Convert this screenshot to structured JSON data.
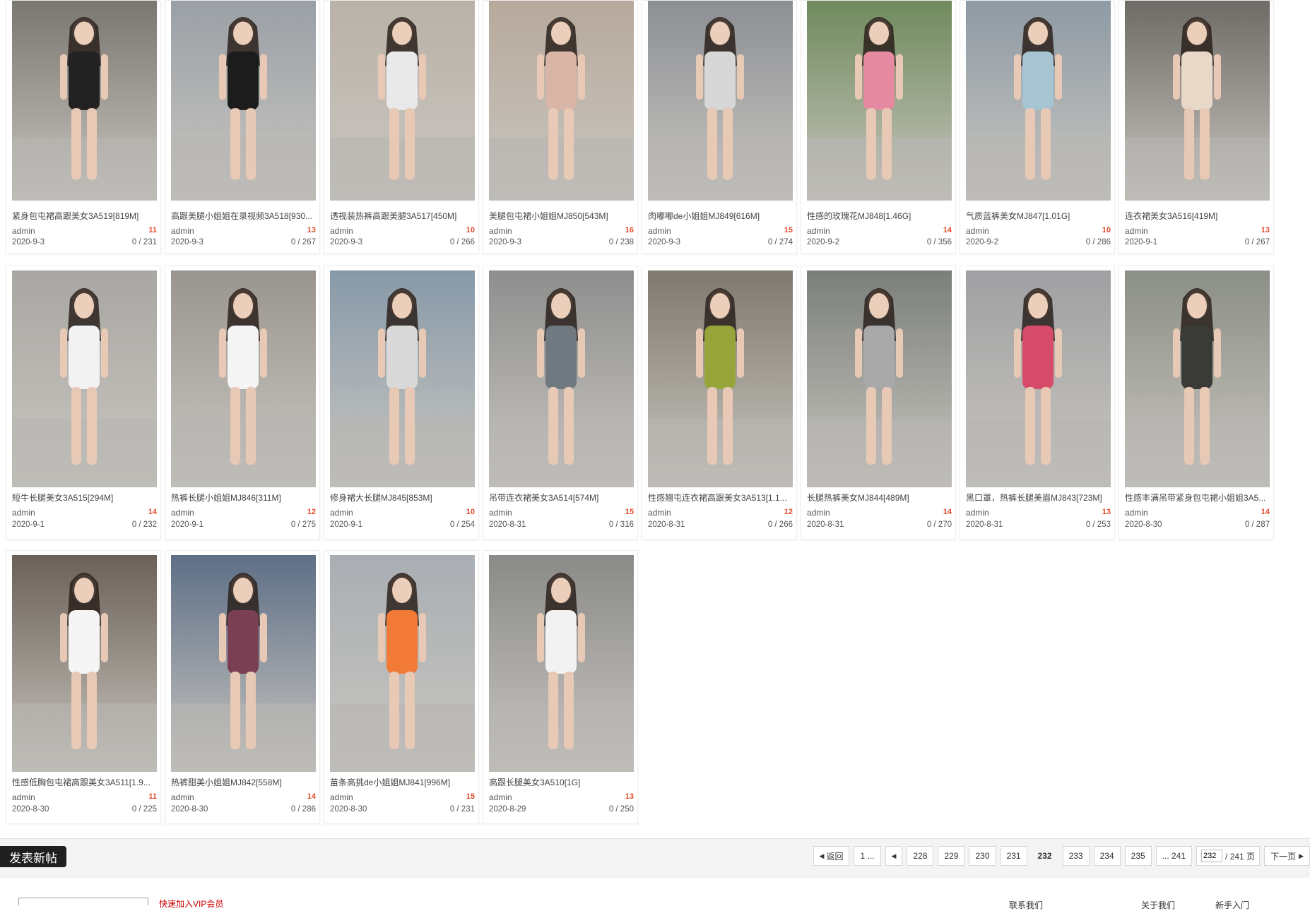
{
  "rows": [
    [
      {
        "title": "紧身包屯裙高跟美女3A519[819M]",
        "author": "admin",
        "comments": "11",
        "date": "2020-9-3",
        "stats": "0 / 231"
      },
      {
        "title": "高跟美腿小姐姐在录视频3A518[930...",
        "author": "admin",
        "comments": "13",
        "date": "2020-9-3",
        "stats": "0 / 267"
      },
      {
        "title": "透视装热裤高跟美腿3A517[450M]",
        "author": "admin",
        "comments": "10",
        "date": "2020-9-3",
        "stats": "0 / 266"
      },
      {
        "title": "美腿包屯裙小姐姐MJ850[543M]",
        "author": "admin",
        "comments": "16",
        "date": "2020-9-3",
        "stats": "0 / 238"
      },
      {
        "title": "肉嘟嘟de小姐姐MJ849[616M]",
        "author": "admin",
        "comments": "15",
        "date": "2020-9-3",
        "stats": "0 / 274"
      },
      {
        "title": "性感的玫瑰花MJ848[1.46G]",
        "author": "admin",
        "comments": "14",
        "date": "2020-9-2",
        "stats": "0 / 356"
      },
      {
        "title": "气质蓝裤美女MJ847[1.01G]",
        "author": "admin",
        "comments": "10",
        "date": "2020-9-2",
        "stats": "0 / 286"
      },
      {
        "title": "连衣裙美女3A516[419M]",
        "author": "admin",
        "comments": "13",
        "date": "2020-9-1",
        "stats": "0 / 267"
      }
    ],
    [
      {
        "title": "短牛长腿美女3A515[294M]",
        "author": "admin",
        "comments": "14",
        "date": "2020-9-1",
        "stats": "0 / 232"
      },
      {
        "title": "热裤长腿小姐姐MJ846[311M]",
        "author": "admin",
        "comments": "12",
        "date": "2020-9-1",
        "stats": "0 / 275"
      },
      {
        "title": "修身裙大长腿MJ845[853M]",
        "author": "admin",
        "comments": "10",
        "date": "2020-9-1",
        "stats": "0 / 254"
      },
      {
        "title": "吊带连衣裙美女3A514[574M]",
        "author": "admin",
        "comments": "15",
        "date": "2020-8-31",
        "stats": "0 / 316"
      },
      {
        "title": "性感翘屯连衣裙高跟美女3A513[1.1...",
        "author": "admin",
        "comments": "12",
        "date": "2020-8-31",
        "stats": "0 / 266"
      },
      {
        "title": "长腿热裤美女MJ844[489M]",
        "author": "admin",
        "comments": "14",
        "date": "2020-8-31",
        "stats": "0 / 270"
      },
      {
        "title": "黑口罩，热裤长腿美眉MJ843[723M]",
        "author": "admin",
        "comments": "13",
        "date": "2020-8-31",
        "stats": "0 / 253"
      },
      {
        "title": "性感丰满吊带紧身包屯裙小姐姐3A5...",
        "author": "admin",
        "comments": "14",
        "date": "2020-8-30",
        "stats": "0 / 287"
      }
    ],
    [
      {
        "title": "性感低胸包屯裙高跟美女3A511[1.9...",
        "author": "admin",
        "comments": "11",
        "date": "2020-8-30",
        "stats": "0 / 225"
      },
      {
        "title": "热裤甜美小姐姐MJ842[558M]",
        "author": "admin",
        "comments": "14",
        "date": "2020-8-30",
        "stats": "0 / 286"
      },
      {
        "title": "苗条高挑de小姐姐MJ841[996M]",
        "author": "admin",
        "comments": "15",
        "date": "2020-8-30",
        "stats": "0 / 231"
      },
      {
        "title": "高跟长腿美女3A510[1G]",
        "author": "admin",
        "comments": "13",
        "date": "2020-8-29",
        "stats": "0 / 250"
      }
    ]
  ],
  "thumb_colors": [
    [
      "#7a7670",
      "#9aa0a6",
      "#b9b2a8",
      "#b7a99c",
      "#8c8f94",
      "#6f8a5c",
      "#8e9aa4",
      "#6e6a66"
    ],
    [
      "#a9a7a3",
      "#9a9590",
      "#8799a8",
      "#8e8e8e",
      "#7f7a6f",
      "#7b7f7a",
      "#9fa0a2",
      "#8b8f86"
    ],
    [
      "#6b6158",
      "#5e6f86",
      "#a9aeb3",
      "#8a8a88"
    ]
  ],
  "outfit_colors": [
    [
      "#222222",
      "#1c1c1c",
      "#e9e9e9",
      "#d9b5a7",
      "#d7d7d7",
      "#e58aa0",
      "#a7c4d3",
      "#e7d8c7"
    ],
    [
      "#f2f2f2",
      "#f4f4f4",
      "#d9d9d9",
      "#707880",
      "#95a53a",
      "#a9a9a9",
      "#d64b6a",
      "#3a3a36"
    ],
    [
      "#f5f5f5",
      "#7a3f52",
      "#f07a36",
      "#f2f2f2"
    ]
  ],
  "new_post_label": "发表新帖",
  "pager": {
    "prev_label": "返回",
    "first_label": "1 ...",
    "pages": [
      "228",
      "229",
      "230",
      "231",
      "232",
      "233",
      "234",
      "235"
    ],
    "current": "232",
    "last_label": "... 241",
    "page_input": "232",
    "total_label": "/ 241 页",
    "next_label": "下一页"
  },
  "footer": {
    "red_link": "快速加入VIP会员",
    "links": [
      "联系我们",
      "关于我们",
      "新手入门"
    ]
  }
}
